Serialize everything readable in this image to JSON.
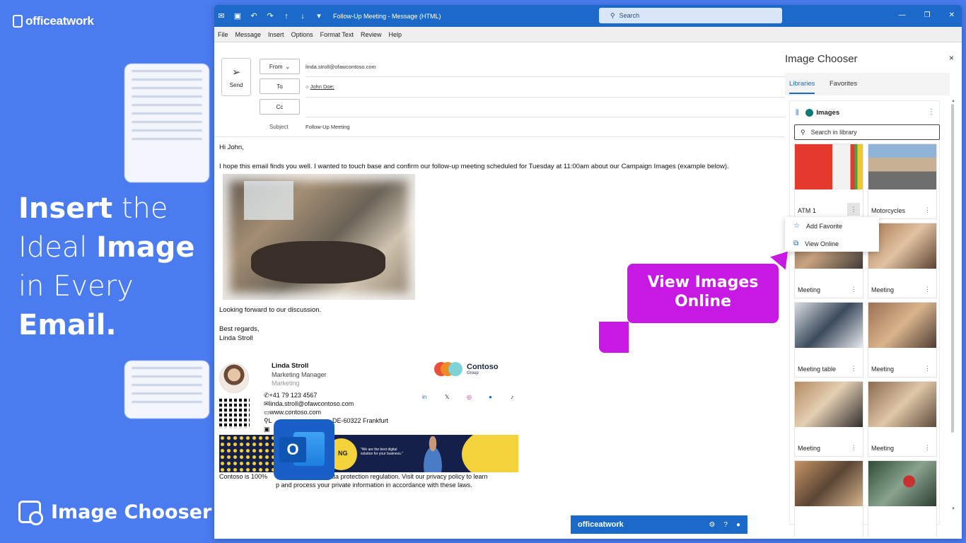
{
  "brand": {
    "name": "officeatwork"
  },
  "headline": {
    "w1": "Insert",
    "w2": "the",
    "w3": "Ideal",
    "w4": "Image",
    "w5": "in Every",
    "w6": "Email."
  },
  "product": {
    "name": "Image Chooser"
  },
  "window": {
    "title": "Follow-Up Meeting  -  Message (HTML)",
    "search_placeholder": "Search",
    "menu": [
      "File",
      "Message",
      "Insert",
      "Options",
      "Format Text",
      "Review",
      "Help"
    ]
  },
  "compose": {
    "send_label": "Send",
    "from_label": "From",
    "from_value": "linda.stroll@ofawcontoso.com",
    "to_label": "To",
    "to_value": "John Doe;",
    "cc_label": "Cc",
    "subject_label": "Subject",
    "subject_value": "Follow-Up Meeting",
    "greeting": "Hi John,",
    "paragraph": "I hope this email finds you well. I wanted to touch base and confirm our follow-up meeting scheduled for Tuesday at 11:00am about our Campaign Images (example below).",
    "closing": "Looking forward to our discussion.",
    "regards": "Best regards,",
    "sender": "Linda Stroll"
  },
  "signature": {
    "name": "Linda Stroll",
    "role": "Marketing Manager",
    "dept": "Marketing",
    "phone": "+41 79 123 4567",
    "email": "linda.stroll@ofawcontoso.com",
    "web": "www.contoso.com",
    "address": "L",
    "address_tail": "DE-60322 Frankfurt",
    "company": "Contoso",
    "company_sub": "Group",
    "banner_quote": "\"We are the best digital solution for your business.\"",
    "banner_text_g": "NG",
    "footer_a": "Contoso is 100%",
    "footer_b": "DPR data protection regulation. Visit our privacy policy to learn",
    "footer_c": "p and process your private information in accordance with these laws."
  },
  "panel": {
    "title": "Image Chooser",
    "tabs": [
      "Libraries",
      "Favorites"
    ],
    "library": "Images",
    "search_placeholder": "Search in library",
    "tiles": [
      {
        "caption": "ATM 1"
      },
      {
        "caption": "Motorcycles"
      },
      {
        "caption": "Meeting"
      },
      {
        "caption": "Meeting"
      },
      {
        "caption": "Meeting table"
      },
      {
        "caption": "Meeting"
      },
      {
        "caption": "Meeting"
      },
      {
        "caption": "Meeting"
      }
    ],
    "menu": [
      "Add Favorite",
      "View Online"
    ],
    "footer": "officeatwork"
  },
  "callout": {
    "line1": "View Images",
    "line2": "Online"
  },
  "colors": {
    "brand_blue": "#4a7cf0",
    "outlook_blue": "#1b6ac9",
    "callout": "#c818e3"
  }
}
